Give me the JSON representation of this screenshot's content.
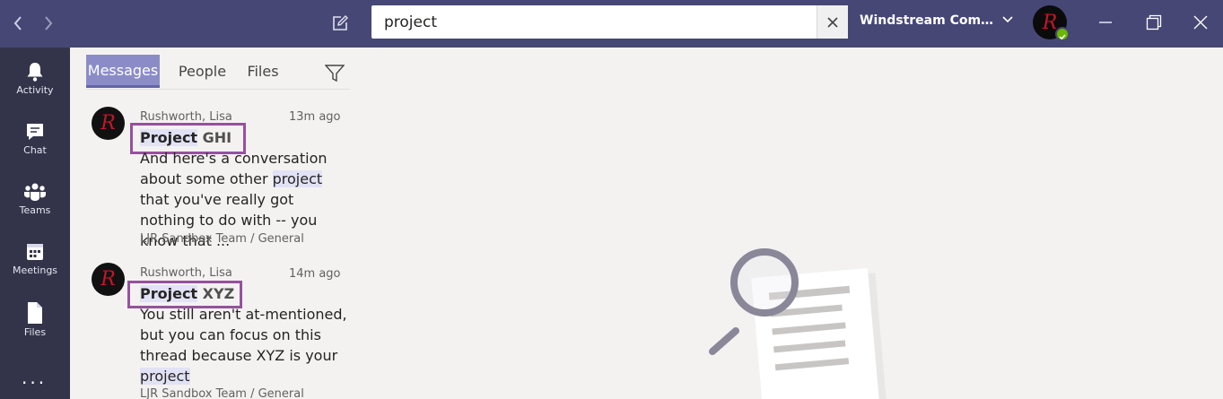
{
  "titlebar": {
    "search_value": "project",
    "org_name": "Windstream Communi...",
    "colors": {
      "bar": "#464775",
      "accent": "#6264a7"
    }
  },
  "rail": {
    "items": [
      {
        "label": "Activity",
        "icon": "bell-icon"
      },
      {
        "label": "Chat",
        "icon": "chat-icon"
      },
      {
        "label": "Teams",
        "icon": "teams-icon"
      },
      {
        "label": "Meetings",
        "icon": "calendar-icon"
      },
      {
        "label": "Files",
        "icon": "file-icon"
      }
    ],
    "more": "..."
  },
  "search_panel": {
    "tabs": [
      {
        "label": "Messages",
        "selected": true
      },
      {
        "label": "People",
        "selected": false
      },
      {
        "label": "Files",
        "selected": false
      }
    ],
    "results": [
      {
        "sender": "Rushworth, Lisa",
        "time": "13m ago",
        "title_match": "Project",
        "title_rest": " GHI",
        "snippet_parts": [
          "And here's a conversation about some other ",
          "project",
          " that you've really got nothing to do with -- you know that ..."
        ],
        "channel": "LJR Sandbox Team / General"
      },
      {
        "sender": "Rushworth, Lisa",
        "time": "14m ago",
        "title_match": "Project",
        "title_rest": " XYZ",
        "snippet_parts": [
          "You still aren't at-mentioned, but you can focus on this thread because XYZ is your ",
          "project",
          ""
        ],
        "channel": "LJR Sandbox Team / General"
      }
    ]
  }
}
